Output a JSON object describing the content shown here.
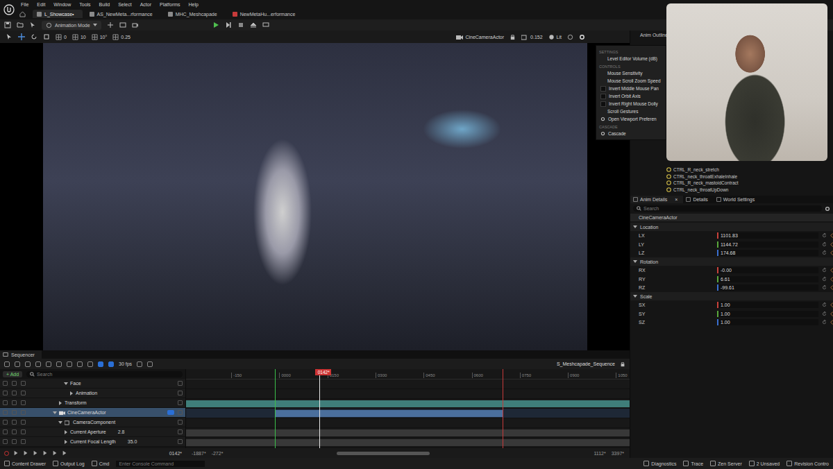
{
  "window": {
    "menubar": [
      "File",
      "Edit",
      "Window",
      "Tools",
      "Build",
      "Select",
      "Actor",
      "Platforms",
      "Help"
    ],
    "tabs": [
      {
        "label": "L_Showcase•",
        "selected": true
      },
      {
        "label": "AS_NewMeta...rformance",
        "selected": false
      },
      {
        "label": "MHC_Meshcapade",
        "selected": false
      },
      {
        "label": "NewMetaHu...erformance",
        "selected": false
      }
    ]
  },
  "toolbar": {
    "mode": "Animation Mode"
  },
  "viewport": {
    "snaps": [
      "0",
      "10",
      "10°",
      "0.25"
    ],
    "camera": "CineCameraActor",
    "speed": "0.152",
    "view_mode": "Lit"
  },
  "viewport_menu": {
    "sections": [
      {
        "header": "SETTINGS",
        "items": [
          {
            "label": "Level Editor Volume (dB)",
            "kind": "value",
            "checked": false
          }
        ]
      },
      {
        "header": "CONTROLS",
        "items": [
          {
            "label": "Mouse Sensitivity",
            "kind": "value",
            "checked": false
          },
          {
            "label": "Mouse Scroll Zoom Speed",
            "kind": "value",
            "checked": false
          },
          {
            "label": "Invert Middle Mouse Pan",
            "kind": "check",
            "checked": false
          },
          {
            "label": "Invert Orbit Axis",
            "kind": "check",
            "checked": false
          },
          {
            "label": "Invert Right Mouse Dolly",
            "kind": "check",
            "checked": false
          },
          {
            "label": "Scroll Gestures",
            "kind": "value",
            "checked": false
          },
          {
            "label": "Open Viewport Preferen",
            "kind": "action",
            "checked": false
          }
        ]
      },
      {
        "header": "CASCADE",
        "items": [
          {
            "label": "Cascade",
            "kind": "action",
            "checked": false
          }
        ]
      }
    ]
  },
  "outliner": {
    "tab": "Anim Outliner",
    "items": [
      "CTRL_R_neck_stretch",
      "CTRL_neck_throatExhaleInhale",
      "CTRL_R_neck_mastoidContract",
      "CTRL_neck_throatUpDown"
    ]
  },
  "details": {
    "tabs": [
      {
        "label": "Anim Details",
        "selected": true,
        "close": "×"
      },
      {
        "label": "Details",
        "selected": false,
        "close": ""
      },
      {
        "label": "World Settings",
        "selected": false,
        "close": ""
      }
    ],
    "search_placeholder": "Search",
    "actor": "CineCameraActor",
    "groups": [
      {
        "label": "Location",
        "expanded": true,
        "fields": [
          {
            "label": "LX",
            "value": "1101.83",
            "color": "#c8413b"
          },
          {
            "label": "LY",
            "value": "1144.72",
            "color": "#5aa83c"
          },
          {
            "label": "LZ",
            "value": "174.68",
            "color": "#3a6fd0"
          }
        ]
      },
      {
        "label": "Rotation",
        "expanded": true,
        "fields": [
          {
            "label": "RX",
            "value": "-0.00",
            "color": "#c8413b"
          },
          {
            "label": "RY",
            "value": "6.61",
            "color": "#5aa83c"
          },
          {
            "label": "RZ",
            "value": "-99.61",
            "color": "#3a6fd0"
          }
        ]
      },
      {
        "label": "Scale",
        "expanded": true,
        "fields": [
          {
            "label": "SX",
            "value": "1.00",
            "color": "#c8413b"
          },
          {
            "label": "SY",
            "value": "1.00",
            "color": "#5aa83c"
          },
          {
            "label": "SZ",
            "value": "1.00",
            "color": "#3a6fd0"
          }
        ]
      }
    ]
  },
  "sequencer": {
    "title": "Sequencer",
    "add": "+ Add",
    "search_placeholder": "Search",
    "fps": "30 fps",
    "sequence": "S_Meshcapade_Sequence",
    "tracks": [
      {
        "label": "Face",
        "kind": "folder",
        "depth": 2,
        "expanded": true,
        "selected": false
      },
      {
        "label": "Animation",
        "kind": "animation",
        "depth": 3,
        "expanded": false,
        "selected": false
      },
      {
        "label": "Transform",
        "kind": "transform",
        "depth": 1,
        "expanded": false,
        "selected": false
      },
      {
        "label": "CineCameraActor",
        "kind": "camera",
        "depth": 0,
        "expanded": true,
        "selected": true
      },
      {
        "label": "CameraComponent",
        "kind": "component",
        "depth": 1,
        "expanded": true,
        "selected": false
      },
      {
        "label": "Current Aperture",
        "kind": "property",
        "depth": 2,
        "expanded": false,
        "selected": false,
        "value": "2.8"
      },
      {
        "label": "Current Focal Length",
        "kind": "property",
        "depth": 2,
        "expanded": false,
        "selected": false,
        "value": "35.0"
      }
    ],
    "ticks": [
      "-150",
      "0000",
      "0150",
      "0300",
      "0450",
      "0600",
      "0750",
      "0900",
      "1050"
    ],
    "playhead": {
      "label": "0142*",
      "level": 0.3
    },
    "range": {
      "start_level": 0.2,
      "end_level": 0.714
    },
    "current_frame": "0142*",
    "view_start": [
      "-1887*",
      "-272*"
    ],
    "view_end": [
      "1112*",
      "3397*"
    ],
    "scroll": {
      "start_level": 0.3,
      "end_level": 0.56
    }
  },
  "status_bar": {
    "left": [
      "Content Drawer",
      "Output Log",
      "Cmd"
    ],
    "console_placeholder": "Enter Console Command",
    "right": [
      "Diagnostics",
      "Trace",
      "Zen Server",
      "2 Unsaved",
      "Revision Contro"
    ]
  }
}
